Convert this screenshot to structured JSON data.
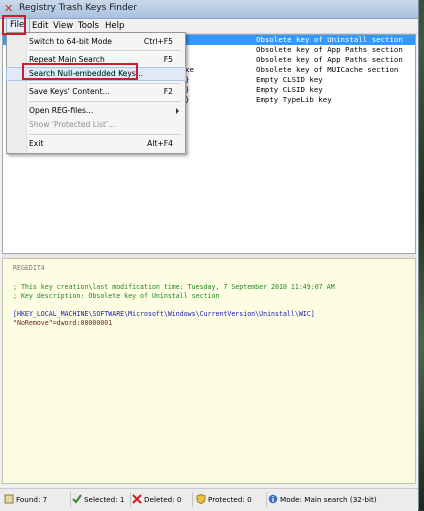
{
  "window": {
    "title": "Registry Trash Keys Finder"
  },
  "menubar": {
    "items": [
      "File",
      "Edit",
      "View",
      "Tools",
      "Help"
    ]
  },
  "file_menu": {
    "items": [
      {
        "label": "Switch to 64-bit Mode",
        "shortcut": "Ctrl+F5",
        "enabled": true
      },
      {
        "label": "Repeat Main Search",
        "shortcut": "F5",
        "enabled": true
      },
      {
        "label": "Search Null-embedded Keys...",
        "shortcut": "",
        "enabled": true
      },
      {
        "label": "Save Keys' Content...",
        "shortcut": "F2",
        "enabled": true
      },
      {
        "label": "Open REG-files...",
        "shortcut": "",
        "enabled": true,
        "submenu": true
      },
      {
        "label": "Show 'Protected List'...",
        "shortcut": "",
        "enabled": false
      },
      {
        "label": "Exit",
        "shortcut": "Alt+F4",
        "enabled": true
      }
    ]
  },
  "results": {
    "rows": [
      {
        "col1": "",
        "col2": "Obsolete key of Uninstall section",
        "selected": true
      },
      {
        "col1": "",
        "col2": "Obsolete key of App Paths section",
        "selected": false
      },
      {
        "col1": "",
        "col2": "Obsolete key of App Paths section",
        "selected": false
      },
      {
        "col1": "xe",
        "col2": "Obsolete key of MUICache section",
        "selected": false
      },
      {
        "col1": "}",
        "col2": "Empty CLSID key",
        "selected": false
      },
      {
        "col1": "}",
        "col2": "Empty CLSID key",
        "selected": false
      },
      {
        "col1": "}",
        "col2": "Empty TypeLib key",
        "selected": false
      }
    ]
  },
  "details": {
    "header": "REGEDIT4",
    "comment1": "; This key creation\\last modification time: Tuesday, 7 September 2010 11:49:07 AM",
    "comment2": "; Key description: Obsolete key of Uninstall section",
    "key_path": "[HKEY_LOCAL_MACHINE\\SOFTWARE\\Microsoft\\Windows\\CurrentVersion\\Uninstall\\WIC]",
    "value_line": "\"NoRemove\"=dword:00000001"
  },
  "statusbar": {
    "found": "Found: 7",
    "selected": "Selected: 1",
    "deleted": "Deleted: 0",
    "protected": "Protected: 0",
    "mode": "Mode: Main search (32-bit)"
  },
  "colors": {
    "highlight_box": "#d01b2a",
    "selection": "#3399ff",
    "details_bg": "#fdfde3"
  }
}
